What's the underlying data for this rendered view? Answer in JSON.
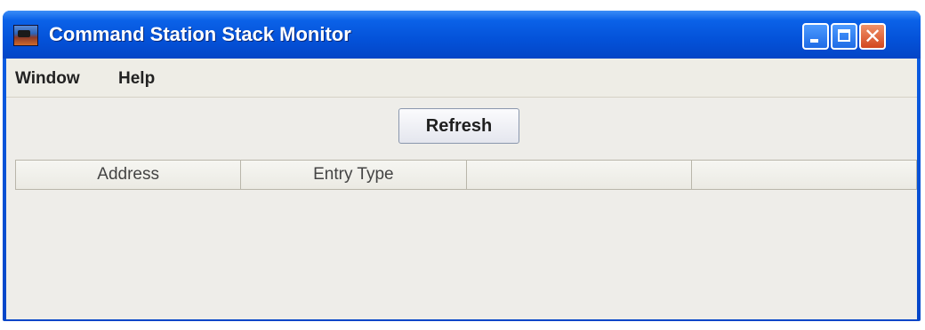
{
  "window": {
    "title": "Command Station Stack Monitor",
    "icon": "app-icon",
    "controls": [
      "minimize-icon",
      "maximize-icon",
      "close-icon"
    ]
  },
  "menubar": {
    "items": [
      {
        "label": "Window"
      },
      {
        "label": "Help"
      }
    ]
  },
  "toolbar": {
    "refresh_label": "Refresh"
  },
  "table": {
    "columns": [
      "Address",
      "Entry Type",
      "",
      ""
    ],
    "rows": []
  },
  "colors": {
    "titlebar": "#0452d9",
    "background": "#ece9d8",
    "close_button": "#d2471e"
  }
}
